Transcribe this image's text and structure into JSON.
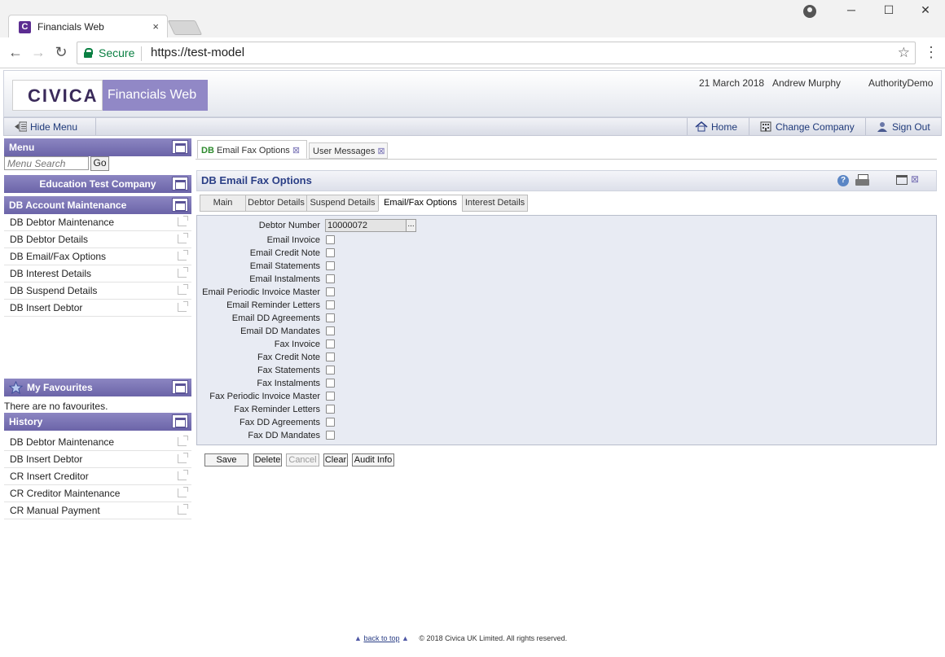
{
  "browser": {
    "tab_title": "Financials Web",
    "tab_close": "×",
    "favicon_letter": "C",
    "secure_label": "Secure",
    "url": "https://test-model",
    "star": "☆",
    "back": "←",
    "forward": "→",
    "reload": "↻",
    "menu": "⋮",
    "minimize": "─",
    "maximize": "☐",
    "close": "✕"
  },
  "header": {
    "logo_text": "CIVICA",
    "app_name": "Financials Web",
    "date": "21 March 2018",
    "user": "Andrew Murphy",
    "authority": "AuthorityDemo"
  },
  "toolbar": {
    "hide_menu": "Hide Menu",
    "home": "Home",
    "change_company": "Change Company",
    "sign_out": "Sign Out"
  },
  "sidebar": {
    "menu_title": "Menu",
    "search_placeholder": "Menu Search",
    "go_label": "Go",
    "company": "Education Test Company",
    "section_title": "DB Account Maintenance",
    "items": [
      "DB Debtor Maintenance",
      "DB Debtor Details",
      "DB Email/Fax Options",
      "DB Interest Details",
      "DB Suspend Details",
      "DB Insert Debtor"
    ],
    "favourites_title": "My Favourites",
    "no_favourites": "There are no favourites.",
    "history_title": "History",
    "history": [
      "DB Debtor Maintenance",
      "DB Insert Debtor",
      "CR Insert Creditor",
      "CR Creditor Maintenance",
      "CR Manual Payment"
    ]
  },
  "page_tabs": {
    "active_prefix": "DB",
    "active_label": " Email Fax Options",
    "second_label": "User Messages",
    "close": "⊠"
  },
  "panel": {
    "title": "DB Email Fax Options",
    "help": "?",
    "close": "⊠"
  },
  "sub_tabs": [
    "Main",
    "Debtor Details",
    "Suspend Details",
    "Email/Fax Options",
    "Interest Details"
  ],
  "form": {
    "debtor_label": "Debtor Number",
    "debtor_value": "10000072",
    "lookup": "...",
    "options": [
      "Email Invoice",
      "Email Credit Note",
      "Email Statements",
      "Email Instalments",
      "Email Periodic Invoice Master",
      "Email Reminder Letters",
      "Email DD Agreements",
      "Email DD Mandates",
      "Fax Invoice",
      "Fax Credit Note",
      "Fax Statements",
      "Fax Instalments",
      "Fax Periodic Invoice Master",
      "Fax Reminder Letters",
      "Fax DD Agreements",
      "Fax DD Mandates"
    ]
  },
  "actions": {
    "save": "Save",
    "delete": "Delete",
    "cancel": "Cancel",
    "clear": "Clear",
    "audit": "Audit Info"
  },
  "footer": {
    "back_to_top": "back to top",
    "copyright": "© 2018 Civica UK Limited. All rights reserved."
  }
}
